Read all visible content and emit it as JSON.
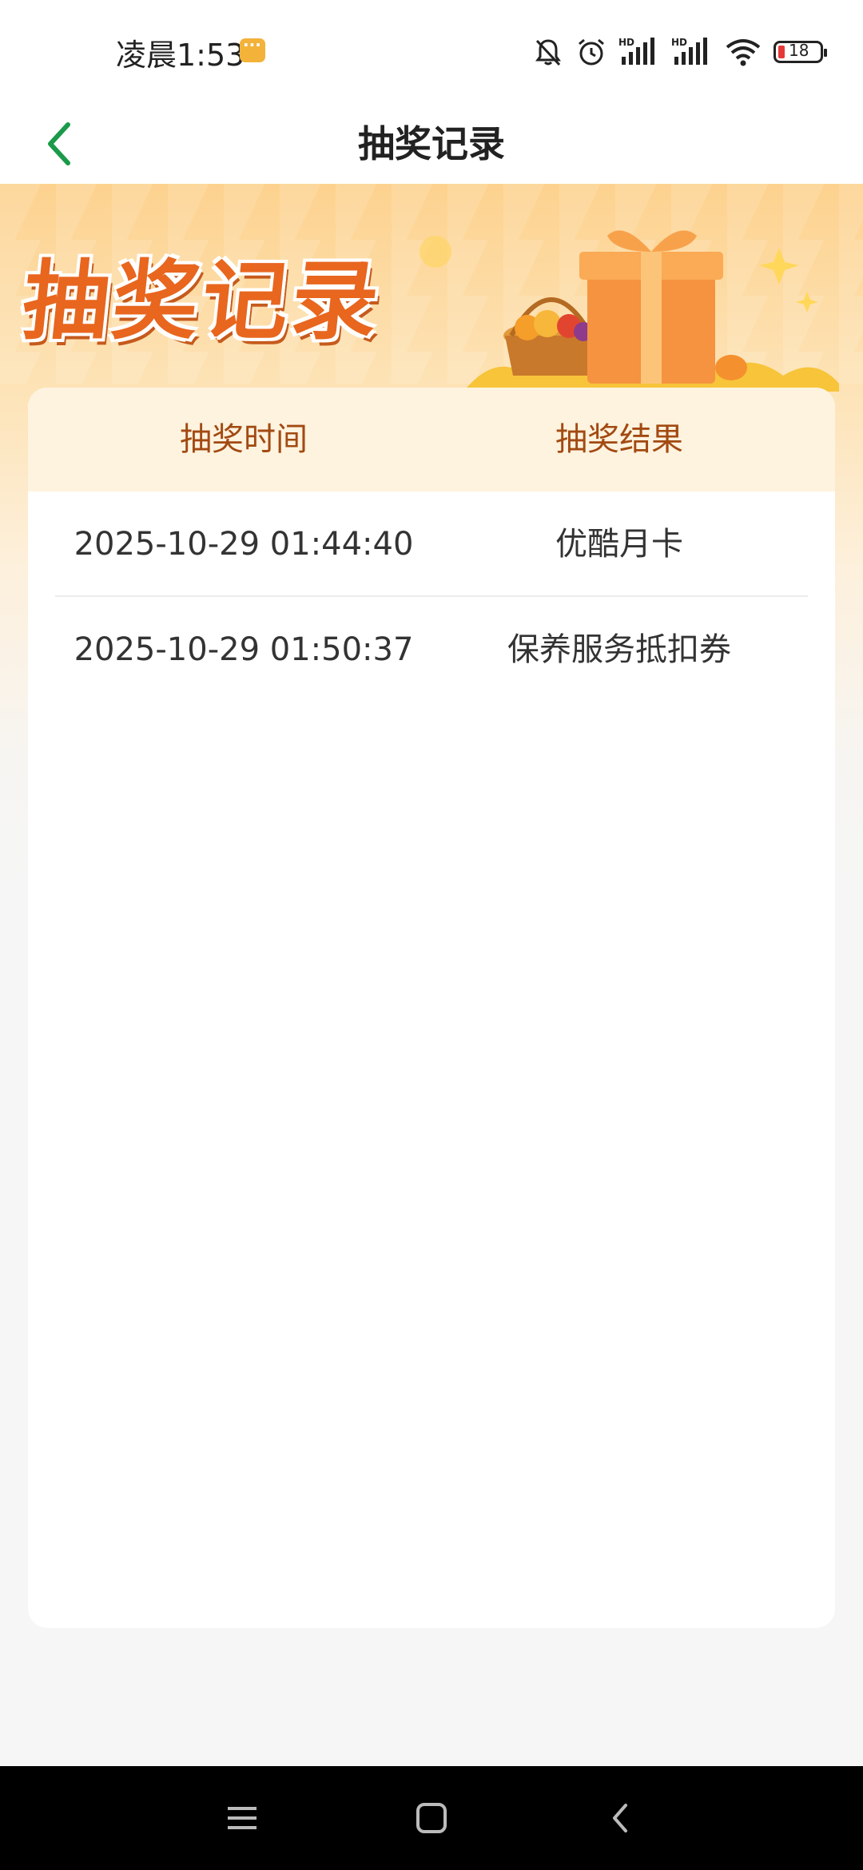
{
  "status_bar": {
    "time": "凌晨1:53",
    "battery_level": "18",
    "icons": [
      "chat-notification-icon",
      "mute-bell-icon",
      "alarm-icon",
      "signal-hd-icon",
      "signal-hd-icon",
      "wifi-icon",
      "battery-icon"
    ]
  },
  "header": {
    "back_icon": "chevron-left-icon",
    "title": "抽奖记录"
  },
  "banner": {
    "title": "抽奖记录"
  },
  "records": {
    "columns": [
      "抽奖时间",
      "抽奖结果"
    ],
    "rows": [
      {
        "time": "2025-10-29 01:44:40",
        "result": "优酷月卡"
      },
      {
        "time": "2025-10-29 01:50:37",
        "result": "保养服务抵扣券"
      }
    ]
  },
  "nav_bar": {
    "icons": [
      "menu-icon",
      "home-icon",
      "back-icon"
    ]
  },
  "colors": {
    "accent_green": "#1a9a4a",
    "header_text": "#a24a12",
    "banner_title": "#e8661e"
  }
}
